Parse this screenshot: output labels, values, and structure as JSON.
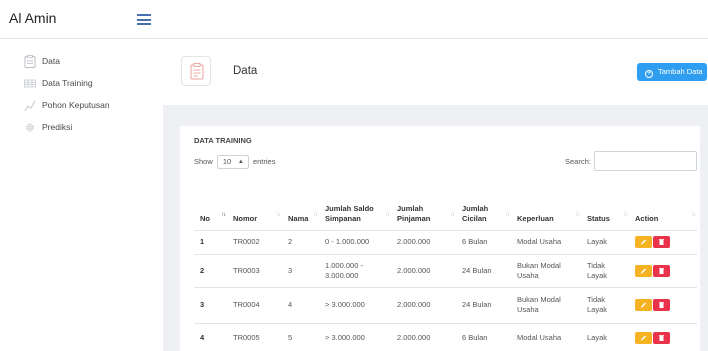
{
  "app": {
    "brand": "Al Amin"
  },
  "sidebar": {
    "items": [
      {
        "label": "Data",
        "icon": "clipboard-icon"
      },
      {
        "label": "Data Training",
        "icon": "table-icon"
      },
      {
        "label": "Pohon Keputusan",
        "icon": "chart-line-icon"
      },
      {
        "label": "Prediksi",
        "icon": "gear-icon"
      }
    ]
  },
  "header": {
    "title": "Data",
    "add_button": "Tambah Data",
    "icon": "clipboard-icon"
  },
  "card": {
    "title": "DATA TRAINING",
    "show_prefix": "Show",
    "show_value": "10",
    "show_suffix": "entries",
    "search_label": "Search:",
    "search_value": ""
  },
  "table": {
    "headers": [
      "No",
      "Nomor",
      "Nama",
      "Jumlah Saldo Simpanan",
      "Jumlah Pinjaman",
      "Jumlah Cicilan",
      "Keperluan",
      "Status",
      "Action"
    ],
    "rows": [
      {
        "no": "1",
        "nomor": "TR0002",
        "nama": "2",
        "saldo": "0 - 1.000.000",
        "pinjaman": "2.000.000",
        "cicilan": "6 Bulan",
        "keperluan": "Modal Usaha",
        "status": "Layak"
      },
      {
        "no": "2",
        "nomor": "TR0003",
        "nama": "3",
        "saldo": "1.000.000 - 3.000.000",
        "pinjaman": "2.000.000",
        "cicilan": "24 Bulan",
        "keperluan": "Bukan Modal Usaha",
        "status": "Tidak Layak"
      },
      {
        "no": "3",
        "nomor": "TR0004",
        "nama": "4",
        "saldo": "> 3.000.000",
        "pinjaman": "2.000.000",
        "cicilan": "24 Bulan",
        "keperluan": "Bukan Modal Usaha",
        "status": "Tidak Layak"
      },
      {
        "no": "4",
        "nomor": "TR0005",
        "nama": "5",
        "saldo": "> 3.000.000",
        "pinjaman": "2.000.000",
        "cicilan": "6 Bulan",
        "keperluan": "Modal Usaha",
        "status": "Layak"
      }
    ]
  },
  "colors": {
    "primary": "#2f9ef0",
    "edit": "#f5b324",
    "delete": "#e8334a",
    "accent_menu": "#4a6fb0"
  }
}
